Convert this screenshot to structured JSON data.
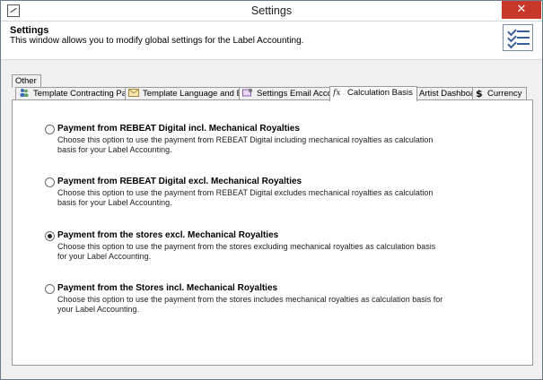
{
  "window": {
    "title": "Settings",
    "close_glyph": "✕"
  },
  "header": {
    "title": "Settings",
    "description": "This window allows you to modify global settings for the Label Accounting.",
    "icon": "checklist-icon"
  },
  "tabs": {
    "row1": [
      {
        "label": "Other"
      }
    ],
    "row2": [
      {
        "label": "Template Contracting Partners",
        "icon": "people-icon"
      },
      {
        "label": "Template Language and Email",
        "icon": "email-icon"
      },
      {
        "label": "Settings Email Account",
        "icon": "email-settings-icon"
      },
      {
        "label": "Calculation Basis",
        "icon": "function-icon",
        "active": true
      },
      {
        "label": "Artist Dashboard",
        "icon": "chart-icon"
      },
      {
        "label": "Currency",
        "icon": "dollar-icon"
      }
    ]
  },
  "options": [
    {
      "title": "Payment from REBEAT Digital incl. Mechanical Royalties",
      "description": "Choose this option to use the payment from REBEAT Digital including mechanical royalties as calculation basis for your Label Accounting.",
      "selected": false
    },
    {
      "title": "Payment from REBEAT Digital excl. Mechanical Royalties",
      "description": "Choose this option to use the payment from REBEAT Digital excludes mechanical royalties as calculation basis for your Label Accounting.",
      "selected": false
    },
    {
      "title": "Payment from the stores excl. Mechanical Royalties",
      "description": "Choose this option to use the payment from the stores excluding mechanical royalties as calculation basis for your Label Accounting.",
      "selected": true
    },
    {
      "title": "Payment from the Stores incl. Mechanical Royalties",
      "description": "Choose this option to use the payment from the stores includes mechanical royalties as calculation basis for your Label Accounting.",
      "selected": false
    }
  ]
}
